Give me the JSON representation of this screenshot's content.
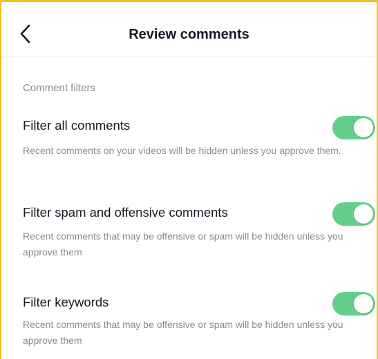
{
  "header": {
    "title": "Review comments",
    "back_icon": "chevron-left-icon"
  },
  "section": {
    "label": "Comment filters"
  },
  "settings": [
    {
      "title": "Filter all comments",
      "description": "Recent comments on your videos will be hidden unless you approve them.",
      "enabled": true
    },
    {
      "title": "Filter spam and offensive comments",
      "description": "Recent comments that may be offensive or spam will be hidden unless you approve them",
      "enabled": true
    },
    {
      "title": "Filter keywords",
      "description": "Recent comments that may be offensive or spam will be hidden unless you approve them",
      "enabled": true
    }
  ],
  "colors": {
    "toggle_on": "#63cf8a",
    "frame_border": "#f3c318",
    "title_text": "#161823",
    "secondary_text": "#8a8b91"
  }
}
